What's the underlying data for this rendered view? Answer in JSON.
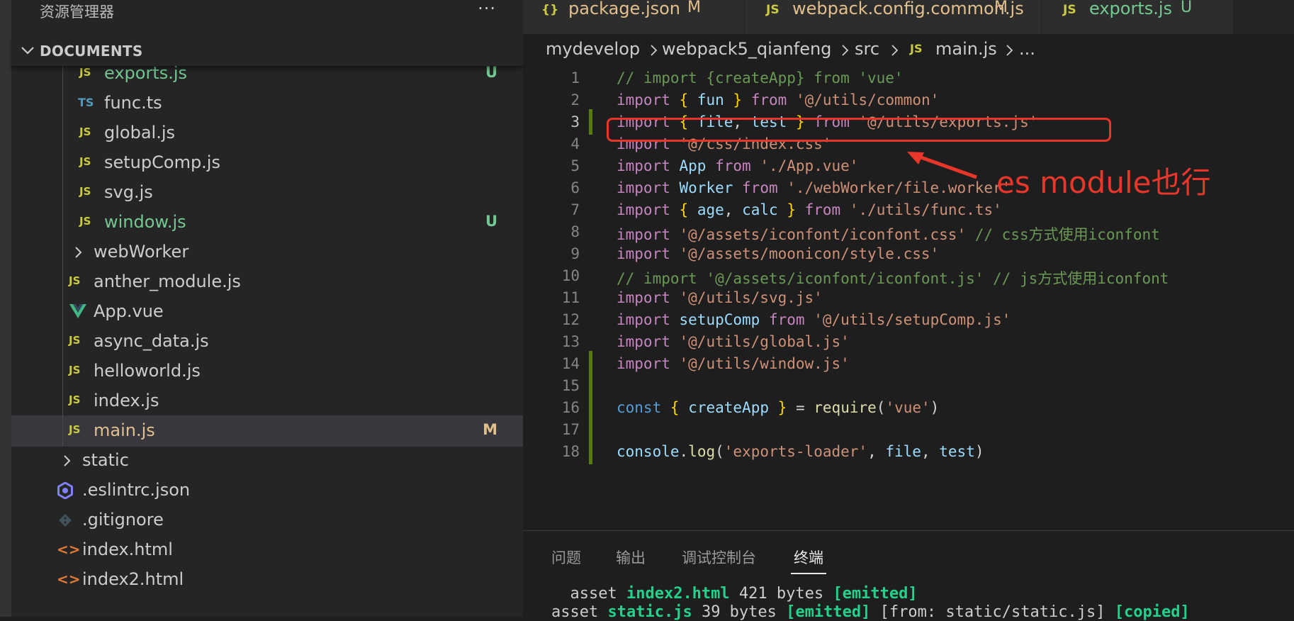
{
  "sidebar": {
    "title": "资源管理器",
    "more": "···",
    "section_title": "DOCUMENTS",
    "items": [
      {
        "label": "exports.js",
        "icon": "js-file-icon",
        "status": "U"
      },
      {
        "label": "func.ts",
        "icon": "ts-file-icon",
        "status": ""
      },
      {
        "label": "global.js",
        "icon": "js-file-icon",
        "status": ""
      },
      {
        "label": "setupComp.js",
        "icon": "js-file-icon",
        "status": ""
      },
      {
        "label": "svg.js",
        "icon": "js-file-icon",
        "status": ""
      },
      {
        "label": "window.js",
        "icon": "js-file-icon",
        "status": "U"
      },
      {
        "label": "webWorker",
        "icon": "folder-chevron-icon",
        "status": ""
      },
      {
        "label": "anther_module.js",
        "icon": "js-file-icon",
        "status": ""
      },
      {
        "label": "App.vue",
        "icon": "vue-file-icon",
        "status": ""
      },
      {
        "label": "async_data.js",
        "icon": "js-file-icon",
        "status": ""
      },
      {
        "label": "helloworld.js",
        "icon": "js-file-icon",
        "status": ""
      },
      {
        "label": "index.js",
        "icon": "js-file-icon",
        "status": ""
      },
      {
        "label": "main.js",
        "icon": "js-file-icon",
        "status": "M"
      },
      {
        "label": "static",
        "icon": "folder-chevron-icon",
        "status": ""
      },
      {
        "label": ".eslintrc.json",
        "icon": "eslint-gear-icon",
        "status": ""
      },
      {
        "label": ".gitignore",
        "icon": "git-icon",
        "status": ""
      },
      {
        "label": "index.html",
        "icon": "html-file-icon",
        "status": ""
      },
      {
        "label": "index2.html",
        "icon": "html-file-icon",
        "status": ""
      }
    ],
    "js_badge": "JS",
    "ts_badge": "TS",
    "html_badge": "<>"
  },
  "tabs": [
    {
      "icon": "{}",
      "label": "package.json",
      "status": "M"
    },
    {
      "icon": "JS",
      "label": "webpack.config.common.js",
      "status": "M"
    },
    {
      "icon": "JS",
      "label": "exports.js",
      "status": "U"
    }
  ],
  "breadcrumb": [
    "mydevelop",
    "webpack5_qianfeng",
    "src",
    "main.js",
    "..."
  ],
  "breadcrumb_icon": "JS",
  "code": [
    "// import {createApp} from 'vue'",
    "import { fun } from '@/utils/common'",
    "import { file, test } from '@/utils/exports.js'",
    "import '@/css/index.css'",
    "import App from './App.vue'",
    "import Worker from './webWorker/file.worker'",
    "import { age, calc } from './utils/func.ts'",
    "import '@/assets/iconfont/iconfont.css' // css方式使用iconfont",
    "import '@/assets/moonicon/style.css'",
    "// import '@/assets/iconfont/iconfont.js' // js方式使用iconfont",
    "import '@/utils/svg.js'",
    "import setupComp from '@/utils/setupComp.js'",
    "import '@/utils/global.js'",
    "import '@/utils/window.js'",
    "",
    "const { createApp } = require('vue')",
    "",
    "console.log('exports-loader', file, test)"
  ],
  "line_numbers": [
    "1",
    "2",
    "3",
    "4",
    "5",
    "6",
    "7",
    "8",
    "9",
    "10",
    "11",
    "12",
    "13",
    "14",
    "15",
    "16",
    "17",
    "18"
  ],
  "annotation": "es module也行",
  "panel": {
    "tabs": [
      "问题",
      "输出",
      "调试控制台",
      "终端"
    ],
    "active_tab": "终端",
    "terminal_lines": [
      "  asset index2.html 421 bytes [emitted]",
      "asset static.js 39 bytes [emitted] [from: static/static.js] [copied]"
    ]
  },
  "colors": {
    "accent_red": "#e8362a",
    "git_untracked": "#73c991",
    "git_modified": "#e2c08d",
    "js_icon": "#cbcb41"
  }
}
